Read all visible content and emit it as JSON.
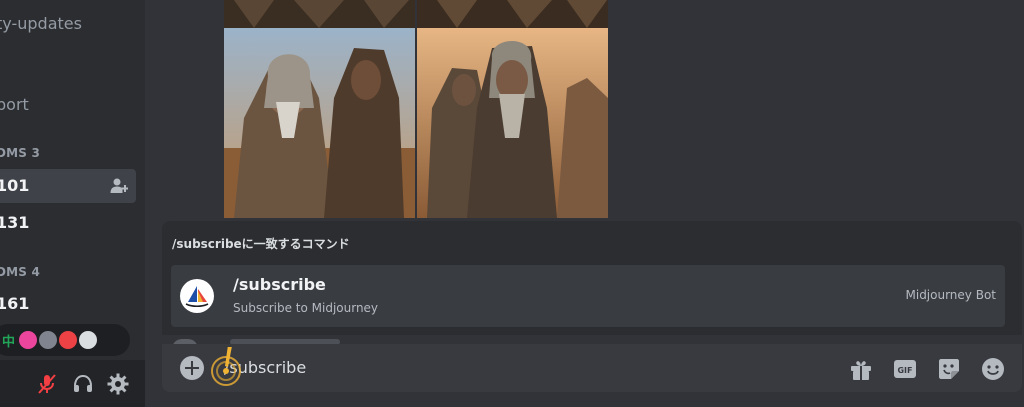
{
  "sidebar": {
    "channels": [
      "ty-updates",
      "port"
    ],
    "categories": [
      "DMS 3",
      "DMS 4"
    ],
    "rooms": [
      {
        "label": "101",
        "active": true
      },
      {
        "label": "131",
        "active": false
      },
      {
        "label": "161",
        "active": false
      }
    ],
    "voice_badge": "中"
  },
  "autocomplete": {
    "header": "/subscribeに一致するコマンド",
    "command": {
      "name": "/subscribe",
      "description": "Subscribe to Midjourney",
      "source": "Midjourney Bot"
    }
  },
  "composer": {
    "value": "/subscribe"
  },
  "colors": {
    "background": "#313338",
    "sidebar": "#2b2d31",
    "composer": "#383a40",
    "muted_red": "#f23f43",
    "online_green": "#23a559",
    "highlight": "#f0b232"
  }
}
